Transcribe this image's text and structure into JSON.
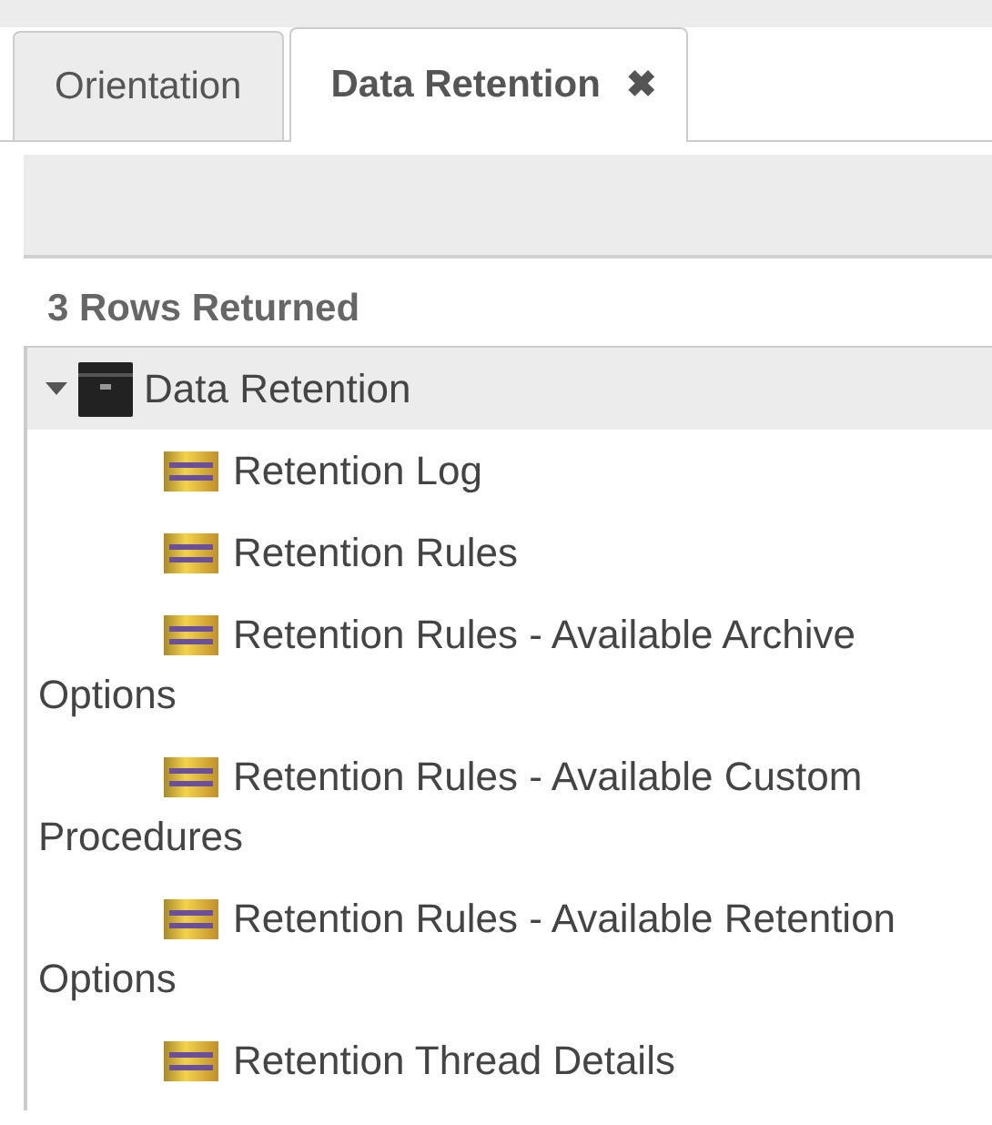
{
  "tabs": [
    {
      "label": "Orientation",
      "selected": false,
      "closable": false
    },
    {
      "label": "Data Retention",
      "selected": true,
      "closable": true,
      "close_glyph": "✖"
    }
  ],
  "rows_returned": "3 Rows Returned",
  "tree": {
    "label": "Data Retention",
    "expanded": true,
    "children": [
      {
        "label": "Retention Log"
      },
      {
        "label": "Retention Rules"
      },
      {
        "label": "Retention Rules - Available Archive Options"
      },
      {
        "label": "Retention Rules - Available Custom Procedures"
      },
      {
        "label": "Retention Rules - Available Retention Options"
      },
      {
        "label": "Retention Thread Details"
      }
    ]
  }
}
